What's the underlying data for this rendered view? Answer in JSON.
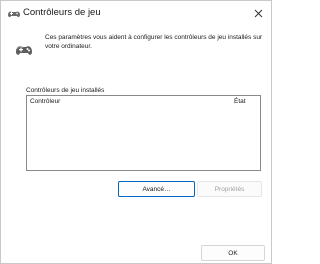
{
  "window": {
    "title": "Contrôleurs de jeu",
    "icon": "gamepad-icon",
    "close_glyph": "✕"
  },
  "info": {
    "icon": "gamepad-icon",
    "text": "Ces paramètres vous aident à configurer les contrôleurs de jeu installés sur votre ordinateur."
  },
  "installed": {
    "label": "Contrôleurs de jeu installés",
    "columns": [
      "Contrôleur",
      "État"
    ],
    "rows": []
  },
  "buttons": {
    "advanced": "Avancé…",
    "properties": "Propriétés",
    "ok": "OK"
  },
  "colors": {
    "accent": "#0067c0",
    "disabled_text": "#a0a0a0",
    "icon_gray": "#6b6b6b"
  }
}
